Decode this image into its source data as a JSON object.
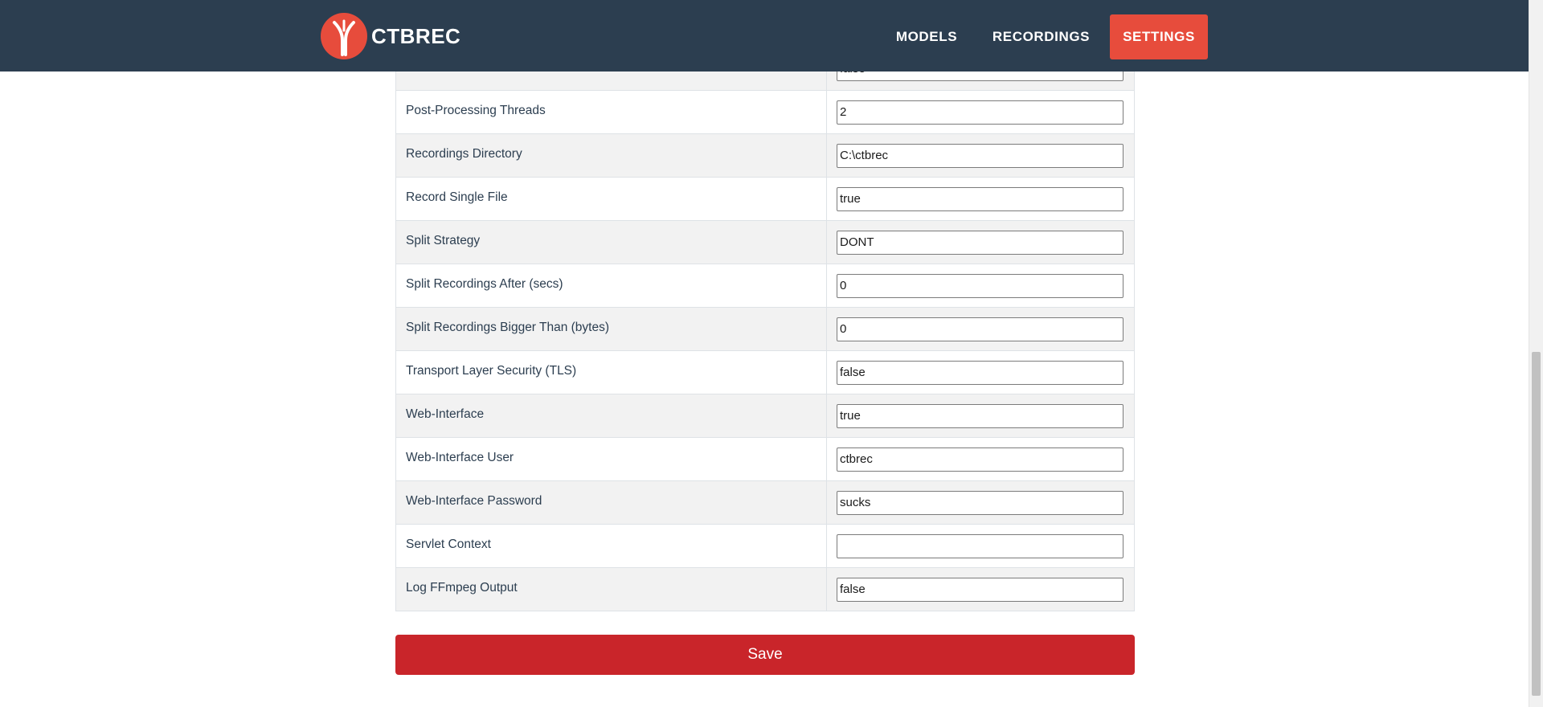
{
  "app": {
    "brand": "CTBREC",
    "nav": [
      {
        "label": "MODELS",
        "active": false
      },
      {
        "label": "RECORDINGS",
        "active": false
      },
      {
        "label": "SETTINGS",
        "active": true
      }
    ]
  },
  "settings": {
    "rows": [
      {
        "label": "",
        "value": "false"
      },
      {
        "label": "Post-Processing Threads",
        "value": "2"
      },
      {
        "label": "Recordings Directory",
        "value": "C:\\ctbrec"
      },
      {
        "label": "Record Single File",
        "value": "true"
      },
      {
        "label": "Split Strategy",
        "value": "DONT"
      },
      {
        "label": "Split Recordings After (secs)",
        "value": "0"
      },
      {
        "label": "Split Recordings Bigger Than (bytes)",
        "value": "0"
      },
      {
        "label": "Transport Layer Security (TLS)",
        "value": "false"
      },
      {
        "label": "Web-Interface",
        "value": "true"
      },
      {
        "label": "Web-Interface User",
        "value": "ctbrec"
      },
      {
        "label": "Web-Interface Password",
        "value": "sucks"
      },
      {
        "label": "Servlet Context",
        "value": ""
      },
      {
        "label": "Log FFmpeg Output",
        "value": "false"
      }
    ],
    "save_label": "Save"
  },
  "colors": {
    "navbar": "#2c3e50",
    "accent": "#e74c3c",
    "save_button": "#c9252a"
  },
  "icons": {
    "logo": "ctbrec-logo-icon"
  }
}
